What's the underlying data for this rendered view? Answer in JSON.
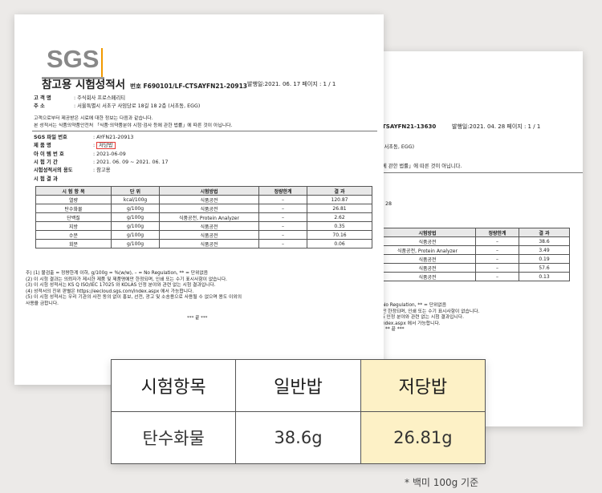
{
  "back_doc": {
    "report_no_fragment": "TSAYFN21-13630",
    "meta": "발행일:2021. 04. 28   페이지 : 1 / 1",
    "addr_fragment": "(서초동, EGG)",
    "law_fragment": "에 관한 법률」에 따른 것이 아닙니다.",
    "date_fragment": "28",
    "table_headers": [
      "시험방법",
      "정량한계",
      "결 과"
    ],
    "rows": [
      [
        "식품공전",
        "–",
        "38.6"
      ],
      [
        "식품공전, Protein Analyzer",
        "–",
        "3.49"
      ],
      [
        "식품공전",
        "–",
        "0.19"
      ],
      [
        "식품공전",
        "–",
        "57.6"
      ],
      [
        "식품공전",
        "–",
        "0.13"
      ]
    ],
    "notes": [
      "No Regulation, ** = 단위없음",
      "만 한정되며, 인쇄 또는 수기 표시사항이 없습니다.",
      "5 인정 분야와 관련 없는 시험 결과입니다.",
      "ndex.aspx 에서 가능합니다.",
      "** 끝 ***"
    ]
  },
  "front_doc": {
    "logo": "SGS",
    "title": "참고용 시험성적서",
    "report_no": "번호 F690101/LF-CTSAYFN21-20913",
    "meta": "발행일:2021. 06. 17   페이지 : 1 / 1",
    "client_label": "고 객 명",
    "client": ": 주식회사 프로스페리티",
    "address_label": "주      소",
    "address": ": 서울특별시 서초구 사임당로 18길 18 2층 (서초동, EGG)",
    "notice1": "고객으로부터 제공받은 시료에 대한 정보는 다음과 같습니다.",
    "notice2": "본 성적서는 식품의약품안전처 「식품·의약품분야 시험·검사 등에 관한 법률」에 따른 것이 아닙니다.",
    "fields": [
      {
        "label": "SGS 파일 번호",
        "value": ": AYFN21-20913"
      },
      {
        "label": "제    품    명",
        "value": ":",
        "highlight": "저당밥"
      },
      {
        "label": "아 이 템 번 호",
        "value": ": 2021-06-09"
      },
      {
        "label": "시  험  기  간",
        "value": ": 2021. 06. 09   ~   2021. 06. 17"
      },
      {
        "label": "시험성적서의 용도",
        "value": ": 참고용"
      }
    ],
    "results_label": "시 험 결 과",
    "table_headers": [
      "시 험 항 목",
      "단 위",
      "시험방법",
      "정량한계",
      "결 과"
    ],
    "rows": [
      [
        "열량",
        "kcal/100g",
        "식품공전",
        "–",
        "120.87"
      ],
      [
        "탄수화물",
        "g/100g",
        "식품공전",
        "–",
        "26.81"
      ],
      [
        "단백질",
        "g/100g",
        "식품공전, Protein Analyzer",
        "–",
        "2.62"
      ],
      [
        "지방",
        "g/100g",
        "식품공전",
        "–",
        "0.35"
      ],
      [
        "수분",
        "g/100g",
        "식품공전",
        "–",
        "70.16"
      ],
      [
        "회분",
        "g/100g",
        "식품공전",
        "–",
        "0.06"
      ]
    ],
    "notes": [
      "주) (1) 불검출 = 정량한계 이하, g/100g = %(w/w), – = No Regulation, ** = 단위없음",
      "     (2) 이 시험 결과는 의뢰자가 제시한 제품 및 제품명에만 한정되며, 인쇄 또는 수기 표시사항이 없습니다.",
      "     (3) 이 시험 성적서는 KS Q ISO/IEC 17025 와 KOLAS 인정 분야와 관련 없는 시험 결과입니다.",
      "     (4) 성적서의 진위 판별은 https://eecloud.sgs.com/index.aspx 에서 가능합니다.",
      "     (5) 이 시험 성적서는 우리 기관의 사전 동의 없이 홍보, 선전, 광고 및 소송용으로 사용될 수 없으며 용도 이외의",
      "          사용을 금합니다."
    ],
    "end_mark": "*** 끝 ***"
  },
  "comparison": {
    "headers": [
      "시험항목",
      "일반밥",
      "저당밥"
    ],
    "row_label": "탄수화물",
    "values": [
      "38.6g",
      "26.81g"
    ],
    "highlight_color": "#fdf1c6"
  },
  "footnote": "* 백미 100g 기준"
}
